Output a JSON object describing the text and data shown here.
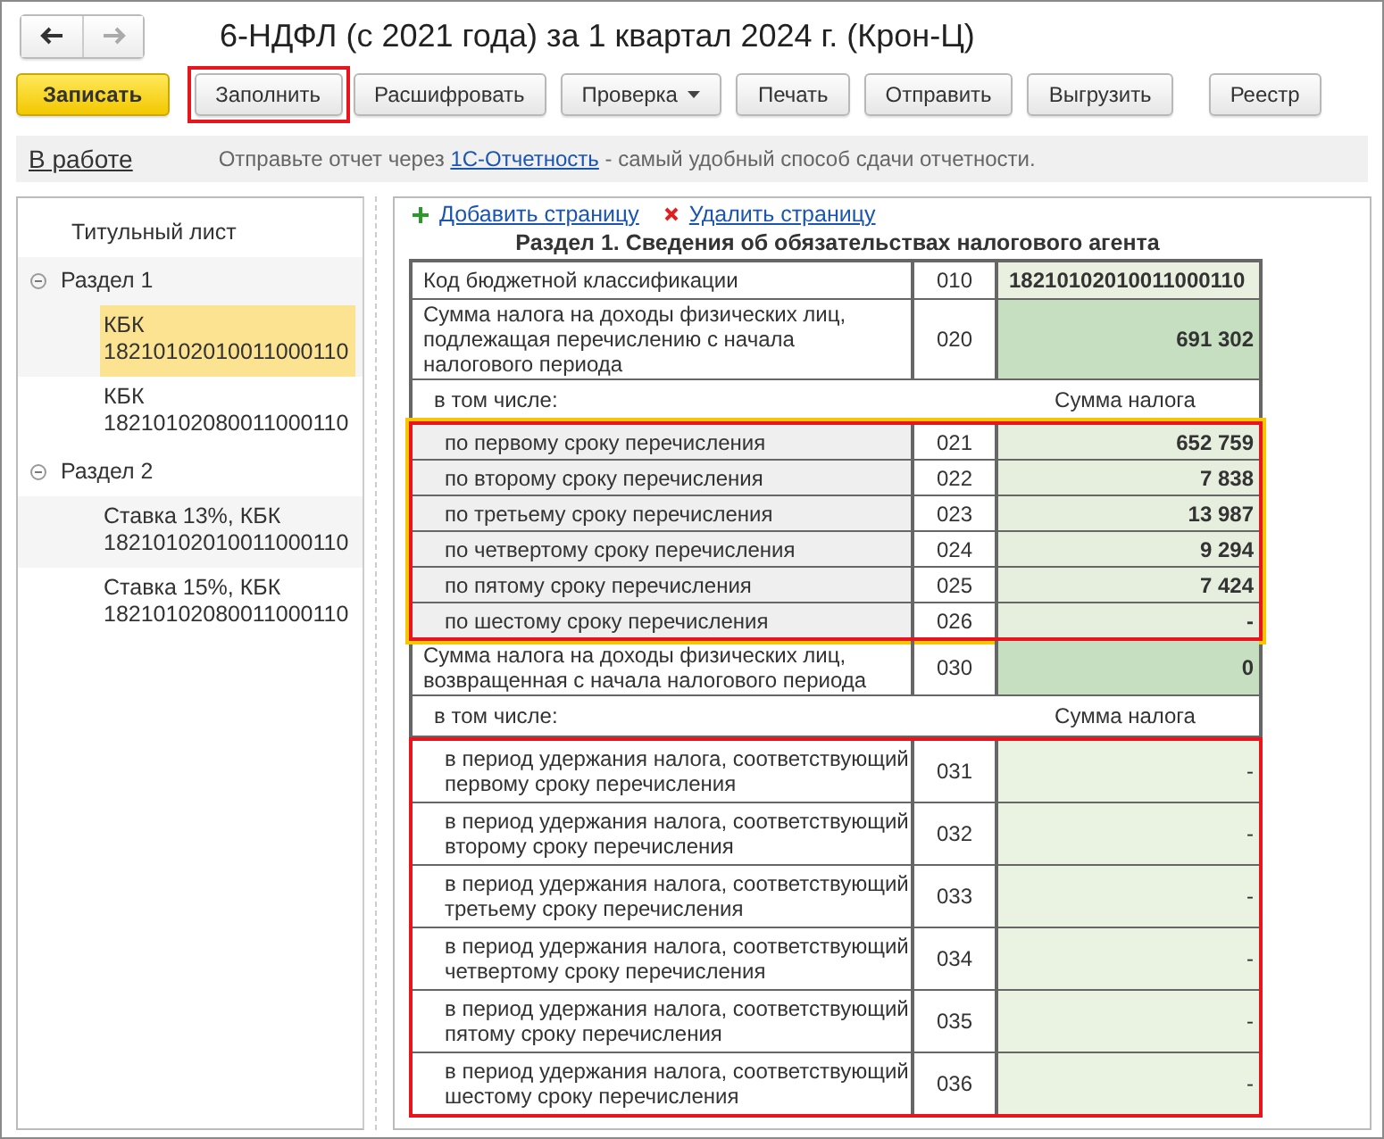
{
  "window": {
    "title": "6-НДФЛ (с 2021 года) за 1 квартал 2024 г. (Крон-Ц)"
  },
  "toolbar": [
    {
      "label": "Записать",
      "kind": "primary",
      "highlighted": false
    },
    {
      "label": "Заполнить",
      "kind": "plain",
      "highlighted": true
    },
    {
      "label": "Расшифровать",
      "kind": "plain",
      "highlighted": false
    },
    {
      "label": "Проверка",
      "kind": "dropdown",
      "highlighted": false
    },
    {
      "label": "Печать",
      "kind": "plain",
      "highlighted": false
    },
    {
      "label": "Отправить",
      "kind": "plain",
      "highlighted": false
    },
    {
      "label": "Выгрузить",
      "kind": "plain",
      "highlighted": false
    },
    {
      "label": "Реестр",
      "kind": "plain",
      "highlighted": false
    }
  ],
  "info_bar": {
    "status": "В работе",
    "message_before": "Отправьте отчет через ",
    "message_link": "1С-Отчетность",
    "message_after": " - самый удобный способ сдачи отчетности."
  },
  "sidebar": {
    "items": [
      {
        "label": "Титульный лист",
        "selected": false
      },
      {
        "label": "Раздел 1",
        "selected": false,
        "expanded": true,
        "children": [
          {
            "label": "КБК\n18210102010011000110",
            "selected": true
          },
          {
            "label": "КБК\n18210102080011000110",
            "selected": false
          }
        ]
      },
      {
        "label": "Раздел 2",
        "selected": false,
        "expanded": true,
        "children": [
          {
            "label": "Ставка 13%, КБК\n18210102010011000110",
            "selected": false
          },
          {
            "label": "Ставка 15%, КБК\n18210102080011000110",
            "selected": false
          }
        ]
      }
    ]
  },
  "page_actions": [
    {
      "label": "Добавить страницу",
      "kind": "add"
    },
    {
      "label": "Удалить страницу",
      "kind": "remove"
    }
  ],
  "table": {
    "title": "Раздел 1. Сведения об обязательствах налогового агента",
    "sections": [
      {
        "kind": "row",
        "label": "Код бюджетной классификации",
        "code": "010",
        "value": "18210102010011000110",
        "strong": false
      },
      {
        "kind": "row",
        "label": "Сумма налога на доходы физических лиц,\nподлежащая перечислению с начала\nналогового периода",
        "code": "020",
        "value": "691 302",
        "strong": true
      },
      {
        "kind": "subheader",
        "label": "в том числе:",
        "column_label": "Сумма налога"
      },
      {
        "kind": "group",
        "yellow_outline": true,
        "shaded": true,
        "rows": [
          {
            "label": "по первому сроку перечисления",
            "code": "021",
            "value": "652 759"
          },
          {
            "label": "по второму сроку перечисления",
            "code": "022",
            "value": "7 838"
          },
          {
            "label": "по третьему сроку перечисления",
            "code": "023",
            "value": "13 987"
          },
          {
            "label": "по четвертому сроку перечисления",
            "code": "024",
            "value": "9 294"
          },
          {
            "label": "по пятому сроку перечисления",
            "code": "025",
            "value": "7 424"
          },
          {
            "label": "по шестому сроку перечисления",
            "code": "026",
            "value": "-"
          }
        ]
      },
      {
        "kind": "row",
        "label": "Сумма налога на доходы физических лиц,\nвозвращенная с начала налогового периода",
        "code": "030",
        "value": "0",
        "strong": true
      },
      {
        "kind": "subheader",
        "label": "в том числе:",
        "column_label": "Сумма налога"
      },
      {
        "kind": "group",
        "yellow_outline": false,
        "shaded": false,
        "rows": [
          {
            "label": "в период удержания налога, соответствующий\nпервому сроку перечисления",
            "code": "031",
            "value": "-"
          },
          {
            "label": "в период удержания налога, соответствующий\nвторому сроку перечисления",
            "code": "032",
            "value": "-"
          },
          {
            "label": "в период удержания налога, соответствующий\nтретьему сроку перечисления",
            "code": "033",
            "value": "-"
          },
          {
            "label": "в период удержания налога, соответствующий\nчетвертому сроку перечисления",
            "code": "034",
            "value": "-"
          },
          {
            "label": "в период удержания налога, соответствующий\nпятому сроку перечисления",
            "code": "035",
            "value": "-"
          },
          {
            "label": "в период удержания налога, соответствующий\nшестому сроку перечисления",
            "code": "036",
            "value": "-"
          }
        ]
      }
    ]
  }
}
